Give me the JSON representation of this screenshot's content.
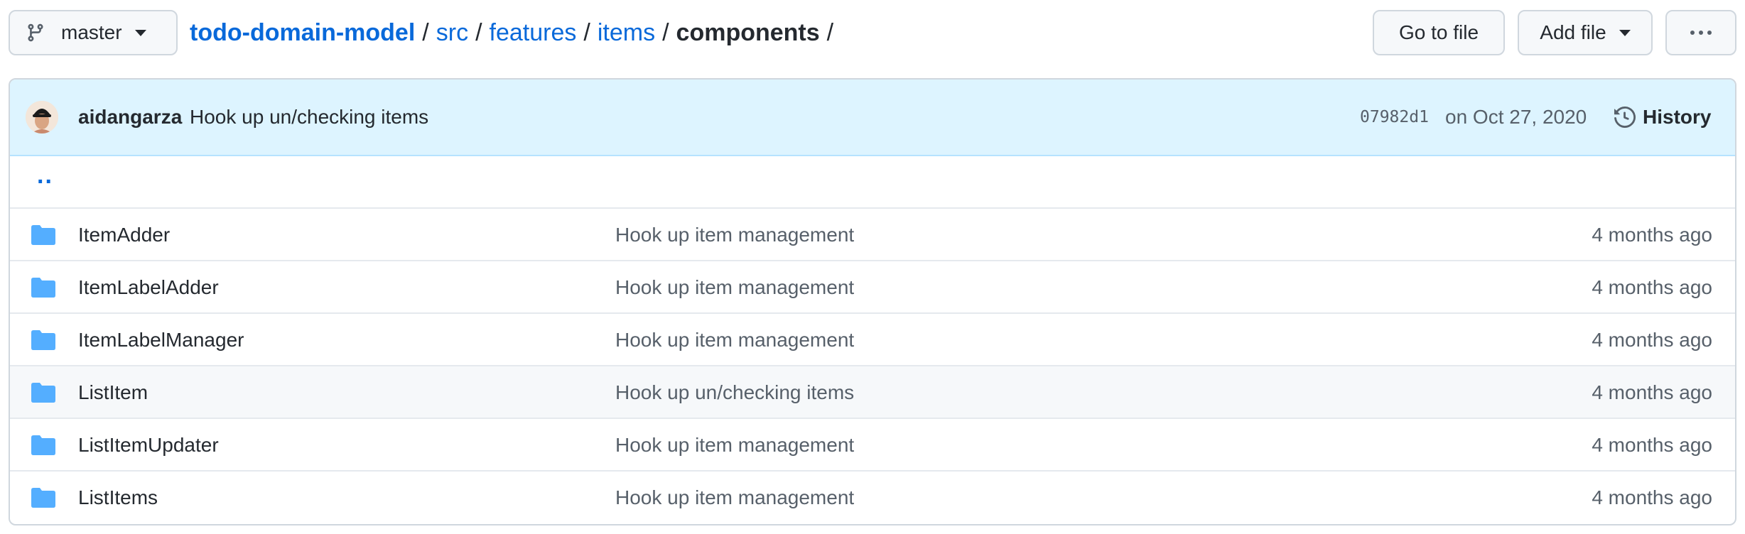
{
  "toolbar": {
    "branch": "master",
    "goto_file": "Go to file",
    "add_file": "Add file"
  },
  "breadcrumb": {
    "repo": "todo-domain-model",
    "parts": [
      "src",
      "features",
      "items"
    ],
    "current": "components",
    "separator": "/"
  },
  "commit": {
    "author": "aidangarza",
    "message": "Hook up un/checking items",
    "sha": "07982d1",
    "date": "on Oct 27, 2020",
    "history_label": "History"
  },
  "parent_link": "..",
  "files": [
    {
      "name": "ItemAdder",
      "message": "Hook up item management",
      "age": "4 months ago",
      "type": "folder"
    },
    {
      "name": "ItemLabelAdder",
      "message": "Hook up item management",
      "age": "4 months ago",
      "type": "folder"
    },
    {
      "name": "ItemLabelManager",
      "message": "Hook up item management",
      "age": "4 months ago",
      "type": "folder"
    },
    {
      "name": "ListItem",
      "message": "Hook up un/checking items",
      "age": "4 months ago",
      "type": "folder"
    },
    {
      "name": "ListItemUpdater",
      "message": "Hook up item management",
      "age": "4 months ago",
      "type": "folder"
    },
    {
      "name": "ListItems",
      "message": "Hook up item management",
      "age": "4 months ago",
      "type": "folder"
    }
  ],
  "colors": {
    "link": "#0969da",
    "folder": "#54aeff",
    "commit_bar_bg": "#ddf4ff"
  },
  "icons": {
    "branch": "git-branch-icon",
    "caret": "caret-down-icon",
    "more": "kebab-horizontal-icon",
    "history": "history-icon",
    "folder": "folder-icon"
  }
}
